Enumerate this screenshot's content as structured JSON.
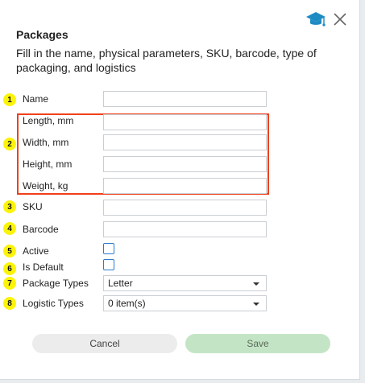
{
  "dialog": {
    "title": "Packages",
    "subtitle": "Fill in the name, physical parameters, SKU, barcode, type of packaging, and logistics"
  },
  "icons": {
    "help": "graduation-cap-icon",
    "close": "close-icon"
  },
  "badges": [
    "1",
    "2",
    "3",
    "4",
    "5",
    "6",
    "7",
    "8"
  ],
  "fields": {
    "name": {
      "label": "Name",
      "value": ""
    },
    "length": {
      "label": "Length, mm",
      "value": ""
    },
    "width": {
      "label": "Width, mm",
      "value": ""
    },
    "height": {
      "label": "Height, mm",
      "value": ""
    },
    "weight": {
      "label": "Weight, kg",
      "value": ""
    },
    "sku": {
      "label": "SKU",
      "value": ""
    },
    "barcode": {
      "label": "Barcode",
      "value": ""
    },
    "active": {
      "label": "Active",
      "checked": false
    },
    "is_default": {
      "label": "Is Default",
      "checked": false
    },
    "package_types": {
      "label": "Package Types",
      "value": "Letter"
    },
    "logistic_types": {
      "label": "Logistic Types",
      "value": "0 item(s)"
    }
  },
  "buttons": {
    "cancel": "Cancel",
    "save": "Save"
  },
  "colors": {
    "badge": "#fbf40a",
    "highlight_border": "#f0401a",
    "checkbox_border": "#2b7cd3",
    "save_button": "#c4e5c5",
    "cancel_button": "#ececec",
    "cap_icon": "#1e8bc3"
  }
}
